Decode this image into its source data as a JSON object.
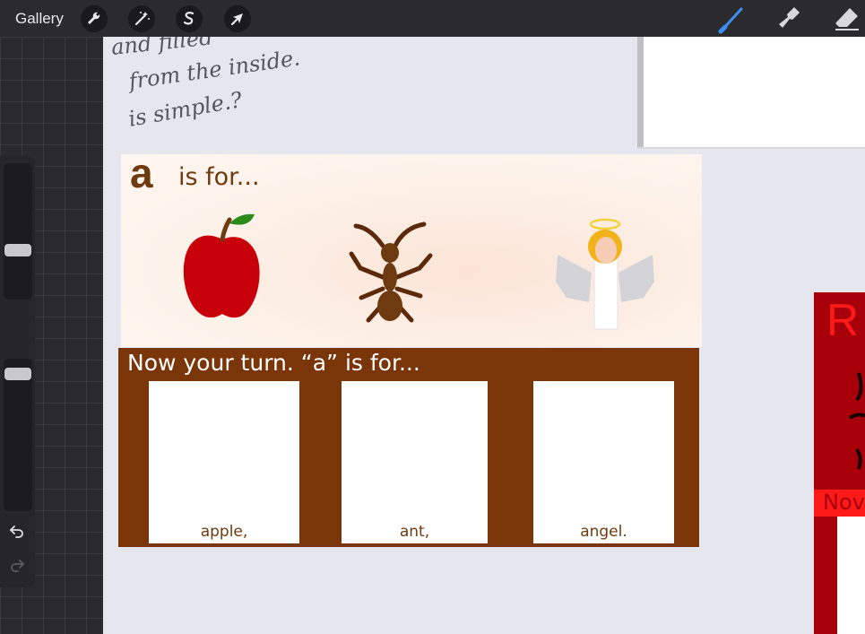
{
  "toolbar": {
    "gallery_label": "Gallery",
    "left_tools": [
      "wrench-icon",
      "magic-wand-icon",
      "selection-icon",
      "transform-arrow-icon"
    ],
    "right_tools": [
      "brush-icon",
      "smudge-icon",
      "eraser-icon"
    ],
    "accent_color": "#3a8ef6"
  },
  "sidebar": {
    "brush_size_level": 0.6,
    "opacity_level": 0.95
  },
  "canvas": {
    "handwriting": [
      "and filled",
      "from the inside.",
      "is simple.?"
    ],
    "top_card": {
      "letter": "a",
      "caption": "is for...",
      "pictures": [
        "apple",
        "ant",
        "angel"
      ]
    },
    "bottom_card": {
      "prompt": "Now your turn. “a” is for...",
      "boxes": [
        "apple,",
        "ant,",
        "angel."
      ]
    },
    "side_card": {
      "letter": "R",
      "caption": "Nov"
    }
  },
  "colors": {
    "brown": "#7a3508",
    "red": "#a8000a",
    "bright_red": "#ff1a1a"
  }
}
